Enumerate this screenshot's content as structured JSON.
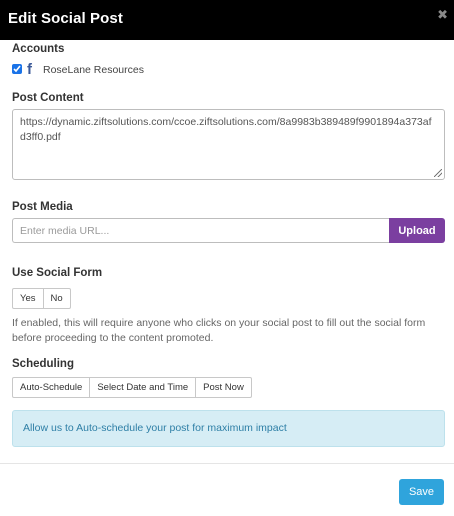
{
  "dialog": {
    "title": "Edit Social Post",
    "close_glyph": "✖"
  },
  "accounts": {
    "label": "Accounts",
    "items": [
      {
        "name": "RoseLane Resources",
        "network": "facebook",
        "icon_glyph": "f",
        "checked": true
      }
    ]
  },
  "post_content": {
    "label": "Post Content",
    "value": "https://dynamic.ziftsolutions.com/ccoe.ziftsolutions.com/8a9983b389489f9901894a373afd3ff0.pdf"
  },
  "post_media": {
    "label": "Post Media",
    "placeholder": "Enter media URL...",
    "upload_label": "Upload"
  },
  "social_form": {
    "label": "Use Social Form",
    "options": [
      "Yes",
      "No"
    ],
    "help": "If enabled, this will require anyone who clicks on your social post to fill out the social form before proceeding to the content promoted."
  },
  "scheduling": {
    "label": "Scheduling",
    "options": [
      "Auto-Schedule",
      "Select Date and Time",
      "Post Now"
    ],
    "info": "Allow us to Auto-schedule your post for maximum impact"
  },
  "footer": {
    "save_label": "Save"
  },
  "colors": {
    "header_bg": "#000000",
    "upload_button": "#7b3fa0",
    "save_button": "#2fa4dc",
    "info_bg": "#d6edf5",
    "info_text": "#2e7fa6",
    "facebook": "#3b5998"
  }
}
